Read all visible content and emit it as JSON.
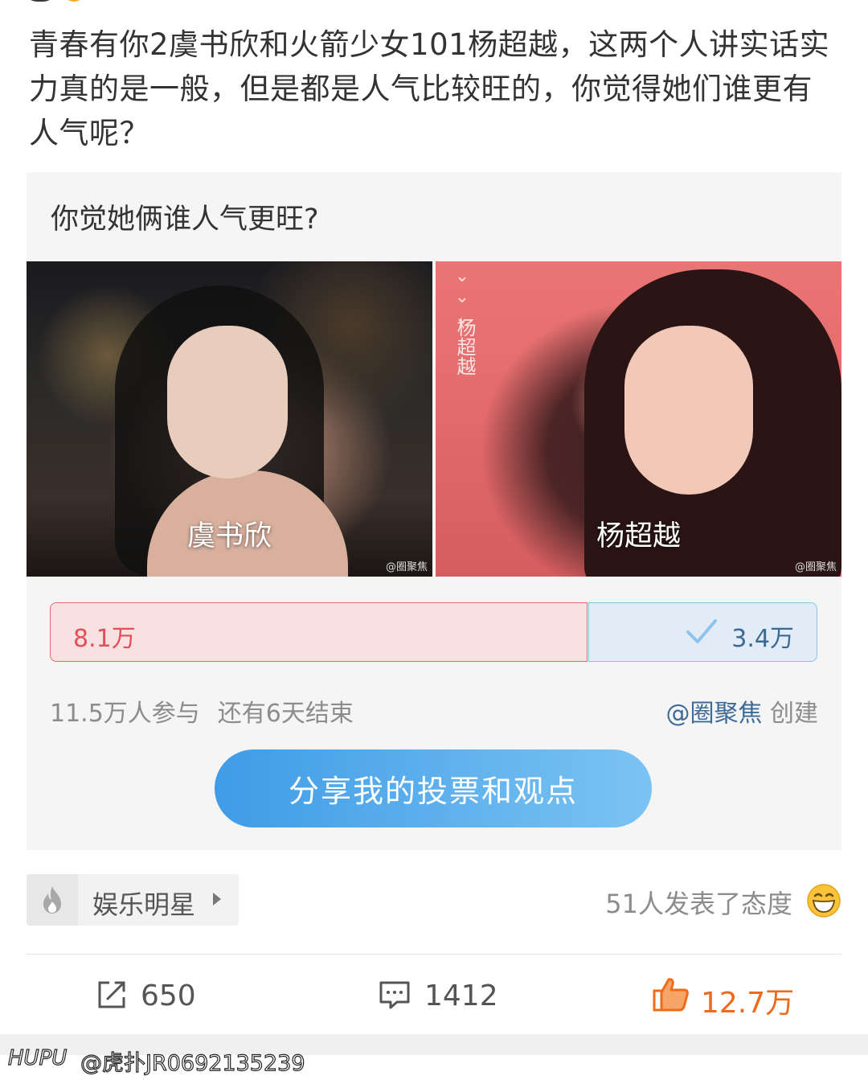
{
  "post": {
    "text": "青春有你2虞书欣和火箭少女101杨超越，这两个人讲实话实力真的是一般，但是都是人气比较旺的，你觉得她们谁更有人气呢？"
  },
  "vote": {
    "question": "你觉她俩谁人气更旺?",
    "left": {
      "name": "虞书欣",
      "count": "8.1万",
      "color": "#e05059"
    },
    "right": {
      "name": "杨超越",
      "side_text": "杨超越",
      "count": "3.4万",
      "color": "#3c6a95",
      "selected": true
    },
    "share_of_votes_left": 0.7,
    "watermark": "@圈聚焦",
    "participants": "11.5万人参与",
    "remaining": "还有6天结束",
    "creator_handle": "@圈聚焦",
    "creator_suffix": "创建",
    "share_button": "分享我的投票和观点"
  },
  "topic": {
    "label": "娱乐明星",
    "icon": "fire-icon"
  },
  "attitude": {
    "text": "51人发表了态度",
    "icon": "grinning-emoji-icon"
  },
  "actions": {
    "repost": {
      "count": "650",
      "icon": "repost-icon"
    },
    "comment": {
      "count": "1412",
      "icon": "comment-icon"
    },
    "like": {
      "count": "12.7万",
      "icon": "thumbs-up-icon",
      "color": "#f06a1b"
    }
  },
  "footer": {
    "brand": "HUPU",
    "user": "@虎扑JR0692135239"
  }
}
